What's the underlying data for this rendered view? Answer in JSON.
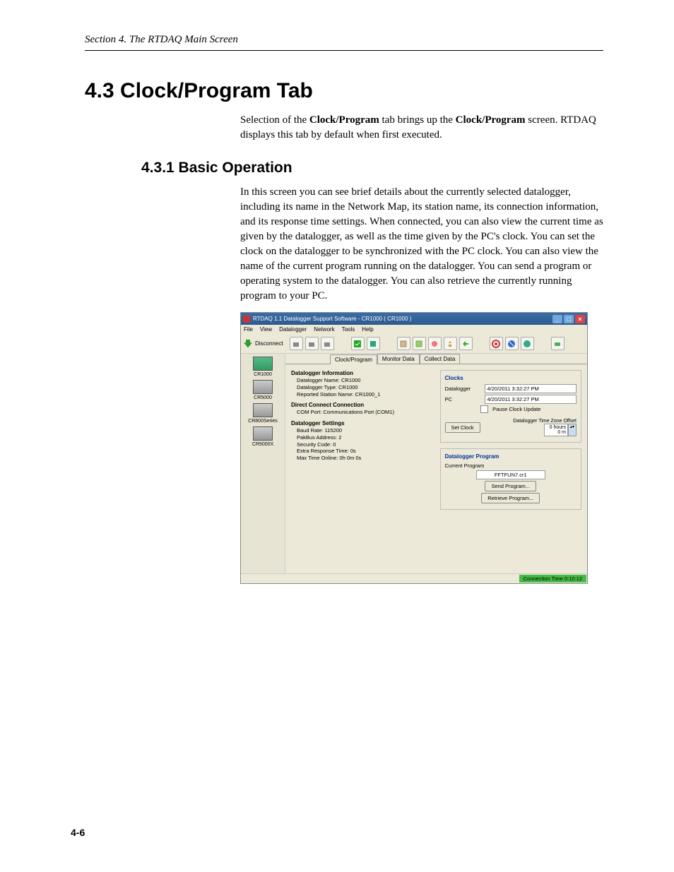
{
  "header": {
    "running": "Section 4.  The RTDAQ Main Screen"
  },
  "h1": "4.3  Clock/Program Tab",
  "p1a": "Selection of the ",
  "p1b": "Clock/Program",
  "p1c": " tab brings up the ",
  "p1d": "Clock/Program",
  "p1e": " screen. RTDAQ displays this tab by default when first executed.",
  "h2": "4.3.1  Basic Operation",
  "p2": "In this screen you can see brief details about the currently selected datalogger, including its name in the Network Map, its station name, its connection information, and its response time settings.  When connected, you can also view the current time as given by the datalogger, as well as the time given by the PC's clock.  You can set the clock on the datalogger to be synchronized with the PC clock.  You can also view the name of the current program running on the datalogger.  You can send a program or operating system to the datalogger.  You can also retrieve the currently running program to your PC.",
  "shot": {
    "title": "RTDAQ 1.1 Datalogger Support Software - CR1000 ( CR1000 )",
    "menu": [
      "File",
      "View",
      "Datalogger",
      "Network",
      "Tools",
      "Help"
    ],
    "disconnect": "Disconnect",
    "tabs": [
      "Clock/Program",
      "Monitor Data",
      "Collect Data"
    ],
    "devices": [
      "CR1000",
      "CR5000",
      "CR800Series",
      "CR9000X"
    ],
    "info": {
      "h1": "Datalogger Information",
      "l1": "Datalogger Name: CR1000",
      "l2": "Datalogger Type: CR1000",
      "l3": "Reported Station Name: CR1000_1",
      "h2": "Direct Connect Connection",
      "l4": "COM Port: Communications Port (COM1)",
      "h3": "Datalogger Settings",
      "l5": "Baud Rate: 115200",
      "l6": "PakBus Address: 2",
      "l7": "Security Code: 0",
      "l8": "Extra Response Time: 0s",
      "l9": "Max Time Online: 0h 0m 0s"
    },
    "clocks": {
      "heading": "Clocks",
      "dlab": "Datalogger",
      "dval": "4/20/2011 3:32:27 PM",
      "plab": "PC",
      "pval": "4/20/2011 3:32:27 PM",
      "pause": "Pause Clock Update",
      "setbtn": "Set Clock",
      "tzlab": "Datalogger Time Zone Offset",
      "tzval": "0 hours 0 m"
    },
    "prog": {
      "heading": "Datalogger Program",
      "curlab": "Current Program",
      "curval": "FFTFUN7.cr1",
      "send": "Send Program...",
      "retr": "Retrieve Program..."
    },
    "status": "Connection Time 0:10:12"
  },
  "pagenum": "4-6"
}
